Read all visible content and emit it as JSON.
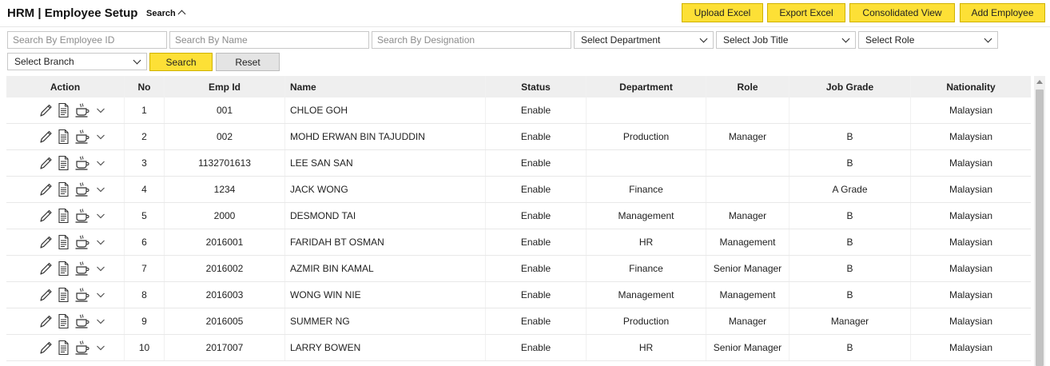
{
  "header": {
    "title": "HRM | Employee Setup",
    "search_toggle": "Search",
    "buttons": {
      "upload_excel": "Upload Excel",
      "export_excel": "Export Excel",
      "consolidated_view": "Consolidated View",
      "add_employee": "Add Employee"
    }
  },
  "filters": {
    "employee_id_placeholder": "Search By Employee ID",
    "name_placeholder": "Search By Name",
    "designation_placeholder": "Search By Designation",
    "department": "Select Department",
    "job_title": "Select Job Title",
    "role": "Select Role",
    "branch": "Select Branch",
    "search_label": "Search",
    "reset_label": "Reset"
  },
  "table": {
    "columns": {
      "action": "Action",
      "no": "No",
      "emp_id": "Emp Id",
      "name": "Name",
      "status": "Status",
      "department": "Department",
      "role": "Role",
      "job_grade": "Job Grade",
      "nationality": "Nationality"
    },
    "rows": [
      {
        "no": "1",
        "emp_id": "001",
        "name": "CHLOE GOH",
        "status": "Enable",
        "department": "",
        "role": "",
        "job_grade": "",
        "nationality": "Malaysian"
      },
      {
        "no": "2",
        "emp_id": "002",
        "name": "MOHD ERWAN BIN TAJUDDIN",
        "status": "Enable",
        "department": "Production",
        "role": "Manager",
        "job_grade": "B",
        "nationality": "Malaysian"
      },
      {
        "no": "3",
        "emp_id": "1132701613",
        "name": "LEE SAN SAN",
        "status": "Enable",
        "department": "",
        "role": "",
        "job_grade": "B",
        "nationality": "Malaysian"
      },
      {
        "no": "4",
        "emp_id": "1234",
        "name": "JACK WONG",
        "status": "Enable",
        "department": "Finance",
        "role": "",
        "job_grade": "A Grade",
        "nationality": "Malaysian"
      },
      {
        "no": "5",
        "emp_id": "2000",
        "name": "DESMOND TAI",
        "status": "Enable",
        "department": "Management",
        "role": "Manager",
        "job_grade": "B",
        "nationality": "Malaysian"
      },
      {
        "no": "6",
        "emp_id": "2016001",
        "name": "FARIDAH BT OSMAN",
        "status": "Enable",
        "department": "HR",
        "role": "Management",
        "job_grade": "B",
        "nationality": "Malaysian"
      },
      {
        "no": "7",
        "emp_id": "2016002",
        "name": "AZMIR BIN KAMAL",
        "status": "Enable",
        "department": "Finance",
        "role": "Senior Manager",
        "job_grade": "B",
        "nationality": "Malaysian"
      },
      {
        "no": "8",
        "emp_id": "2016003",
        "name": "WONG WIN NIE",
        "status": "Enable",
        "department": "Management",
        "role": "Management",
        "job_grade": "B",
        "nationality": "Malaysian"
      },
      {
        "no": "9",
        "emp_id": "2016005",
        "name": "SUMMER NG",
        "status": "Enable",
        "department": "Production",
        "role": "Manager",
        "job_grade": "Manager",
        "nationality": "Malaysian"
      },
      {
        "no": "10",
        "emp_id": "2017007",
        "name": "LARRY BOWEN",
        "status": "Enable",
        "department": "HR",
        "role": "Senior Manager",
        "job_grade": "B",
        "nationality": "Malaysian"
      }
    ]
  },
  "icons": {
    "edit": "pencil-icon",
    "document": "document-icon",
    "leave": "coffee-cup-icon",
    "more": "chevron-down-icon"
  },
  "colors": {
    "accent": "#fde036",
    "accent_border": "#cfb200",
    "header_bg": "#efefef"
  }
}
